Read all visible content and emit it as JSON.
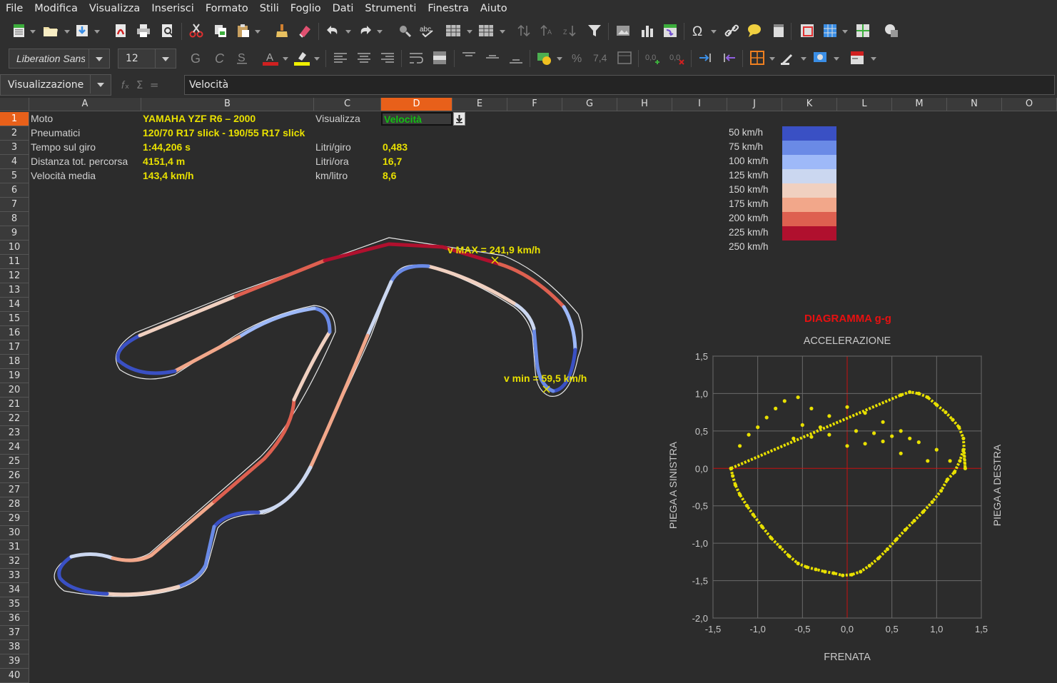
{
  "menu": [
    "File",
    "Modifica",
    "Visualizza",
    "Inserisci",
    "Formato",
    "Stili",
    "Foglio",
    "Dati",
    "Strumenti",
    "Finestra",
    "Aiuto"
  ],
  "toolbar": {
    "font_name": "Liberation Sans",
    "font_size": "12"
  },
  "formula": {
    "name_box": "Visualizzazione",
    "content": "Velocità"
  },
  "columns": [
    "A",
    "B",
    "C",
    "D",
    "E",
    "F",
    "G",
    "H",
    "I",
    "J",
    "K",
    "L",
    "M",
    "N",
    "O"
  ],
  "selected_column": "D",
  "rows": [
    "1",
    "2",
    "3",
    "4",
    "5",
    "6",
    "7",
    "8",
    "9",
    "10",
    "11",
    "12",
    "13",
    "14",
    "15",
    "16",
    "17",
    "18",
    "19",
    "20",
    "21",
    "22",
    "23",
    "24",
    "25",
    "26",
    "27",
    "28",
    "29",
    "30",
    "31",
    "32",
    "33",
    "34",
    "35",
    "36",
    "37",
    "38",
    "39",
    "40"
  ],
  "info": {
    "moto_label": "Moto",
    "moto_value": "YAMAHA YZF R6 – 2000",
    "tyres_label": "Pneumatici",
    "tyres_value": "120/70 R17 slick - 190/55 R17 slick",
    "laptime_label": "Tempo sul giro",
    "laptime_value": "1:44,206 s",
    "distance_label": "Distanza tot. percorsa",
    "distance_value": "4151,4 m",
    "avgspeed_label": "Velocità media",
    "avgspeed_value": "143,4 km/h",
    "show_label": "Visualizza",
    "show_value": "Velocità",
    "litres_lap_label": "Litri/giro",
    "litres_lap_value": "0,483",
    "litres_hour_label": "Litri/ora",
    "litres_hour_value": "16,7",
    "km_litre_label": "km/litro",
    "km_litre_value": "8,6"
  },
  "speed_legend": [
    {
      "label": "50 km/h",
      "color": "#3a50c4"
    },
    {
      "label": "75 km/h",
      "color": "#6a8ae6"
    },
    {
      "label": "100 km/h",
      "color": "#9eb9f8"
    },
    {
      "label": "125 km/h",
      "color": "#cbd7f0"
    },
    {
      "label": "150 km/h",
      "color": "#f0d0c0"
    },
    {
      "label": "175 km/h",
      "color": "#f2a78a"
    },
    {
      "label": "200 km/h",
      "color": "#de6050"
    },
    {
      "label": "225 km/h",
      "color": "#b0102e"
    },
    {
      "label": "250 km/h",
      "color": ""
    }
  ],
  "track": {
    "vmax_label": "v MAX = 241,9 km/h",
    "vmin_label": "v min = 59,5 km/h"
  },
  "gg_chart": {
    "title": "DIAGRAMMA g-g",
    "top_label": "ACCELERAZIONE",
    "bottom_label": "FRENATA",
    "left_label": "PIEGA A SINISTRA",
    "right_label": "PIEGA A DESTRA",
    "x_ticks": [
      "-1,5",
      "-1,0",
      "-0,5",
      "0,0",
      "0,5",
      "1,0",
      "1,5"
    ],
    "y_ticks": [
      "1,5",
      "1,0",
      "0,5",
      "0,0",
      "-0,5",
      "-1,0",
      "-1,5",
      "-2,0"
    ],
    "point_color": "#e8e000"
  },
  "chart_data": {
    "type": "scatter",
    "title": "DIAGRAMMA g-g",
    "xlabel": "FRENATA",
    "ylabel": "PIEGA A SINISTRA",
    "xlim": [
      -1.5,
      1.5
    ],
    "ylim": [
      -2.0,
      1.5
    ],
    "grid": true,
    "series": [
      {
        "x": [
          -1.3,
          -1.28,
          -1.25,
          -1.2,
          -1.12,
          -1.05,
          -0.95,
          -0.85,
          -0.75,
          -0.65,
          -0.55,
          -0.45,
          -0.35,
          -0.25,
          -0.15,
          -0.05,
          0.05,
          0.15,
          0.25,
          0.35,
          0.45,
          0.55,
          0.65,
          0.75,
          0.85,
          0.95,
          1.05,
          1.12,
          1.2,
          1.26,
          1.3,
          1.32,
          1.3,
          1.25,
          1.18,
          1.1,
          1.0,
          0.9,
          0.8,
          0.7,
          0.6,
          -1.2,
          -1.1,
          -1.0,
          -0.9,
          -0.8,
          -0.7,
          -0.55,
          -0.4,
          -0.2,
          0.0,
          0.2,
          0.4,
          0.6,
          0.8,
          1.0,
          1.15,
          -0.6,
          -0.4,
          -0.2,
          0.0,
          0.2,
          0.4,
          0.6,
          0.9,
          -0.5,
          -0.3,
          0.1,
          0.3,
          0.5,
          0.7
        ],
        "y": [
          0.0,
          -0.1,
          -0.22,
          -0.35,
          -0.5,
          -0.62,
          -0.78,
          -0.93,
          -1.05,
          -1.17,
          -1.27,
          -1.32,
          -1.35,
          -1.38,
          -1.4,
          -1.43,
          -1.42,
          -1.38,
          -1.3,
          -1.2,
          -1.08,
          -0.95,
          -0.82,
          -0.7,
          -0.58,
          -0.45,
          -0.3,
          -0.15,
          -0.05,
          0.1,
          0.25,
          0.0,
          0.4,
          0.55,
          0.65,
          0.75,
          0.85,
          0.95,
          1.0,
          1.02,
          0.98,
          0.3,
          0.45,
          0.55,
          0.68,
          0.8,
          0.9,
          0.95,
          0.8,
          0.7,
          0.82,
          0.74,
          0.62,
          0.5,
          0.35,
          0.25,
          0.1,
          0.4,
          0.42,
          0.45,
          0.3,
          0.33,
          0.36,
          0.2,
          0.1,
          0.58,
          0.55,
          0.5,
          0.47,
          0.43,
          0.4
        ]
      }
    ]
  }
}
